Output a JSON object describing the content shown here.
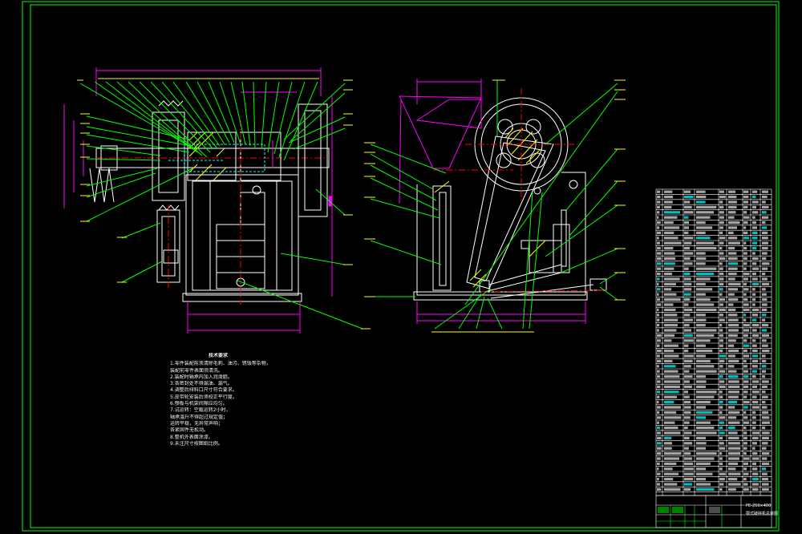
{
  "notes": {
    "title": "技术要求",
    "lines": [
      "1.零件装配前须清除毛刺、油污、锈蚀等杂物，",
      "  装配前零件表面须清洗。",
      "2.装配时轴承内加入润滑脂。",
      "3.各密封处不得漏油、漏气。",
      "4.调整后排料口尺寸符合要求。",
      "5.皮带轮安装后须校正平行度。",
      "6.颚板与机架间隙应均匀。",
      "7.试运转：空载运转2小时，",
      "  轴承温升不得超过规定值；",
      "  运转平稳，无异常声响；",
      "  各紧固件无松动。",
      "8.整机外表面涂漆。",
      "9.未注尺寸按图纸比例。"
    ]
  },
  "title_block": {
    "drawing_no": "PE-250×400",
    "name": "颚式破碎机总装图"
  },
  "colors": {
    "frame": "#00ff00",
    "leader": "#00ff00",
    "outline": "#ffffff",
    "dim": "#ff00ff",
    "center": "#ff0000",
    "section": "#ffff00",
    "hidden": "#00ffff"
  }
}
